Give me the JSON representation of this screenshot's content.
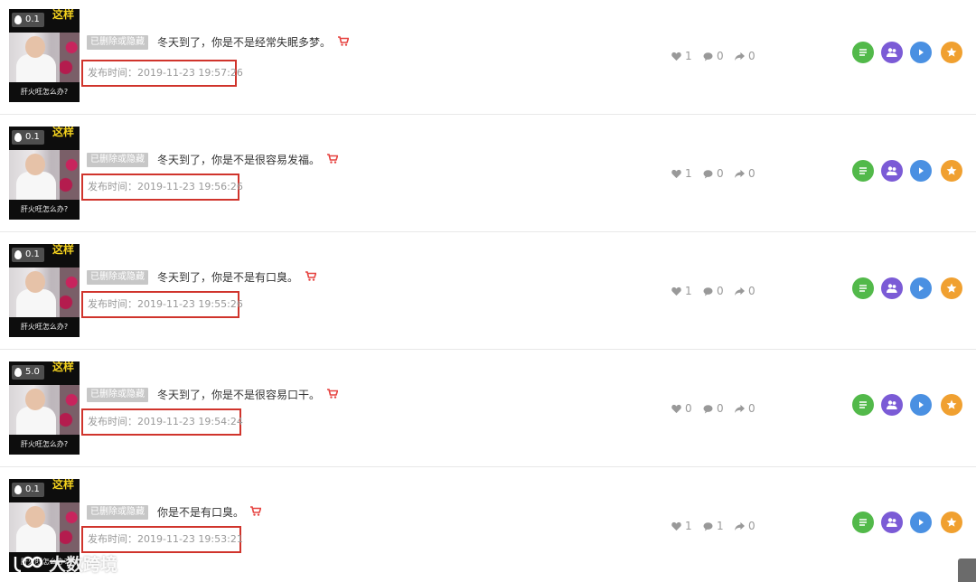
{
  "badge_label": "已删除或隐藏",
  "colors": {
    "like": "#999999",
    "highlight": "#d0342c",
    "cart": "#e64340",
    "action_green": "#52b94a",
    "action_purple": "#7b5bd6",
    "action_blue": "#4a90e2",
    "action_orange": "#f0a030"
  },
  "icons": [
    "heart-icon",
    "comment-icon",
    "share-icon",
    "cart-icon",
    "text-icon",
    "people-icon",
    "play-icon",
    "star-icon"
  ],
  "thumbnail": {
    "yellow_text": "这样",
    "caption": "肝火旺怎么办?"
  },
  "posts": [
    {
      "heat": "0.1",
      "title": "冬天到了，你是不是经常失眠多梦。",
      "time": "发布时间：2019-11-23 19:57:26",
      "likes": "1",
      "comments": "0",
      "shares": "0"
    },
    {
      "heat": "0.1",
      "title": "冬天到了，你是不是很容易发福。",
      "time": "发布时间：2019-11-23 19:56:26",
      "likes": "1",
      "comments": "0",
      "shares": "0"
    },
    {
      "heat": "0.1",
      "title": "冬天到了，你是不是有口臭。",
      "time": "发布时间：2019-11-23 19:55:26",
      "likes": "1",
      "comments": "0",
      "shares": "0"
    },
    {
      "heat": "5.0",
      "title": "冬天到了，你是不是很容易口干。",
      "time": "发布时间：2019-11-23 19:54:24",
      "likes": "0",
      "comments": "0",
      "shares": "0"
    },
    {
      "heat": "0.1",
      "title": "你是不是有口臭。",
      "time": "发布时间：2019-11-23 19:53:21",
      "likes": "1",
      "comments": "1",
      "shares": "0"
    }
  ],
  "watermark": "大数跨境"
}
